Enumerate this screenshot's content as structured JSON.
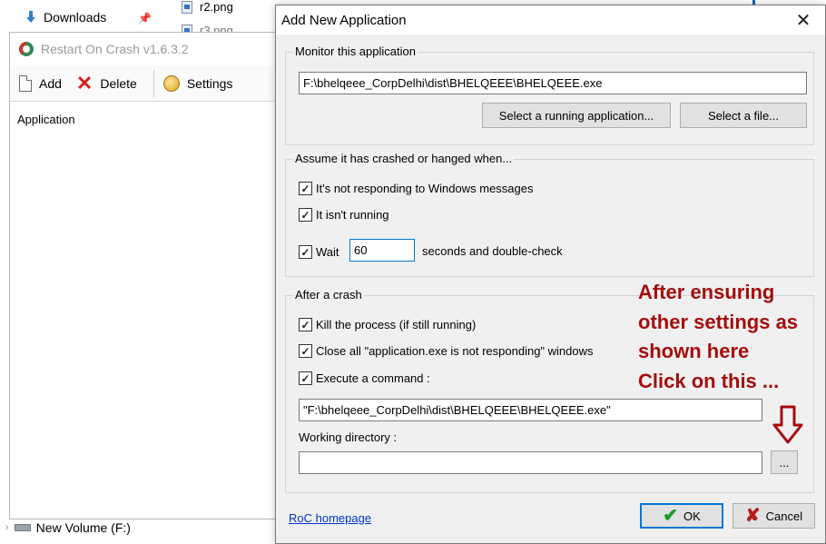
{
  "explorer": {
    "nav": {
      "downloads": "Downloads",
      "new_volume": "New Volume (F:)"
    },
    "files": [
      "r2.png",
      "r3.png"
    ]
  },
  "roc": {
    "title": "Restart On Crash v1.6.3.2",
    "toolbar": {
      "add": "Add",
      "delete": "Delete",
      "settings": "Settings"
    },
    "list_header": "Application"
  },
  "dialog": {
    "title": "Add New Application",
    "monitor": {
      "group_title": "Monitor this application",
      "path_value": "F:\\bhelqeee_CorpDelhi\\dist\\BHELQEEE\\BHELQEEE.exe",
      "select_running_label": "Select a running application...",
      "select_file_label": "Select a file..."
    },
    "assume": {
      "group_title": "Assume it has crashed or hanged when...",
      "not_responding_label": "It's not responding to Windows messages",
      "not_running_label": "It isn't running",
      "wait_label": "Wait",
      "wait_value": "60",
      "wait_suffix": "seconds and double-check"
    },
    "after": {
      "group_title": "After a crash",
      "kill_label": "Kill the process (if still running)",
      "close_label": "Close all \"application.exe is not responding\" windows",
      "execute_label": "Execute a command :",
      "command_value": "\"F:\\bhelqeee_CorpDelhi\\dist\\BHELQEEE\\BHELQEEE.exe\"",
      "working_dir_label": "Working directory :",
      "working_dir_value": "",
      "browse_label": "..."
    },
    "homepage_link": "RoC homepage",
    "ok_label": "OK",
    "cancel_label": "Cancel",
    "checkbox_mark": "✓"
  },
  "annotation": {
    "lines": [
      "After ensuring",
      "other settings as",
      "shown here",
      "Click on this ..."
    ],
    "color": "#a50d0d"
  },
  "colors": {
    "accent": "#0078d7",
    "ok_green": "#169c2b",
    "cancel_red": "#b71c1c"
  }
}
